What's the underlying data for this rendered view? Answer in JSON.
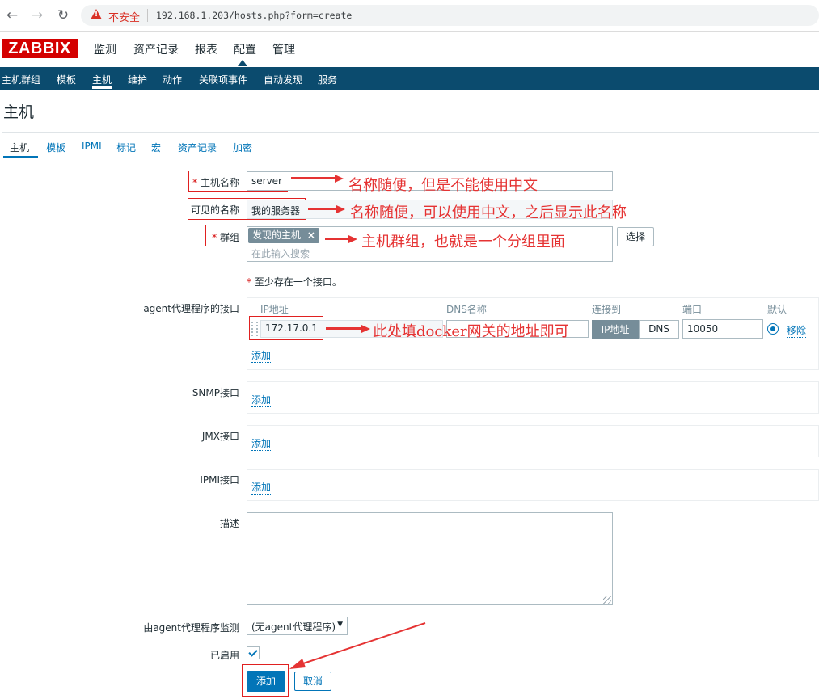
{
  "browser": {
    "back_icon": "arrow-left-icon",
    "forward_icon": "arrow-right-icon",
    "reload_icon": "reload-icon",
    "warning_text": "不安全",
    "url": "192.168.1.203/hosts.php?form=create"
  },
  "app": {
    "logo": "ZABBIX",
    "top_menu": [
      "监测",
      "资产记录",
      "报表",
      "配置",
      "管理"
    ],
    "active_top": "配置",
    "sub_menu": [
      "主机群组",
      "模板",
      "主机",
      "维护",
      "动作",
      "关联项事件",
      "自动发现",
      "服务"
    ],
    "active_sub": "主机"
  },
  "page": {
    "title": "主机"
  },
  "tabs": [
    "主机",
    "模板",
    "IPMI",
    "标记",
    "宏",
    "资产记录",
    "加密"
  ],
  "form": {
    "host_name": {
      "label": "主机名称",
      "value": "server"
    },
    "visible_name": {
      "label": "可见的名称",
      "value": "我的服务器"
    },
    "groups": {
      "label": "群组",
      "tag": "发现的主机",
      "tag_remove": "×",
      "placeholder": "在此输入搜索",
      "select_button": "选择"
    },
    "interface_note": "至少存在一个接口。",
    "agent_interfaces": {
      "label": "agent代理程序的接口",
      "columns": [
        "IP地址",
        "DNS名称",
        "连接到",
        "端口",
        "默认"
      ],
      "ip": "172.17.0.1",
      "dns": "",
      "connect_ip": "IP地址",
      "connect_dns": "DNS",
      "port": "10050",
      "remove": "移除",
      "add": "添加"
    },
    "snmp": {
      "label": "SNMP接口",
      "add": "添加"
    },
    "jmx": {
      "label": "JMX接口",
      "add": "添加"
    },
    "ipmi": {
      "label": "IPMI接口",
      "add": "添加"
    },
    "description": {
      "label": "描述",
      "value": ""
    },
    "monitored_by": {
      "label": "由agent代理程序监测",
      "value": "(无agent代理程序)"
    },
    "enabled": {
      "label": "已启用",
      "checked": true
    },
    "add_button": "添加",
    "cancel_button": "取消"
  },
  "annotations": {
    "host_name": "名称随便，但是不能使用中文",
    "visible_name": "名称随便，可以使用中文，之后显示此名称",
    "groups": "主机群组，也就是一个分组里面",
    "ip": "此处填docker网关的地址即可"
  },
  "colors": {
    "accent": "#0275b8",
    "nav": "#0b4b6e",
    "logo": "#d40000",
    "annotation": "#e53333"
  }
}
